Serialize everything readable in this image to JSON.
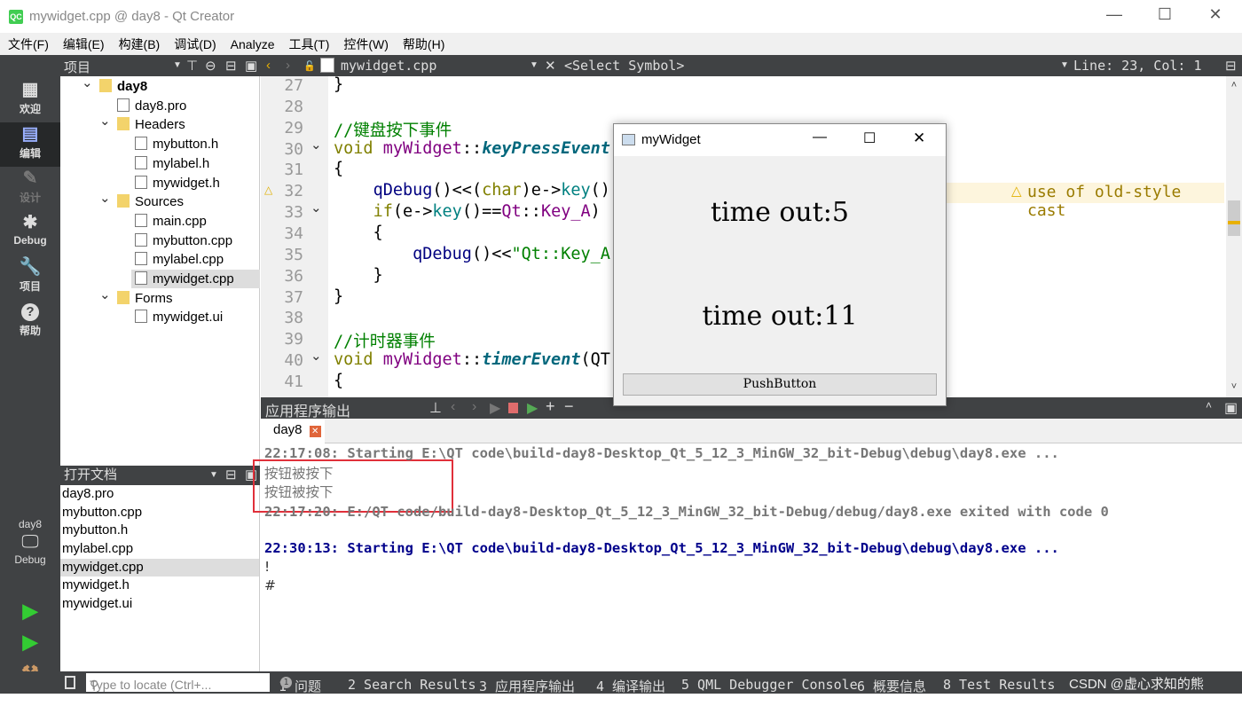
{
  "window": {
    "title": "mywidget.cpp @ day8 - Qt Creator",
    "logo": "QC"
  },
  "menu": [
    "文件(F)",
    "编辑(E)",
    "构建(B)",
    "调试(D)",
    "Analyze",
    "工具(T)",
    "控件(W)",
    "帮助(H)"
  ],
  "toolbar": {
    "panel": "项目",
    "file": "mywidget.cpp",
    "symbol": "<Select Symbol>",
    "position": "Line: 23, Col: 1"
  },
  "modes": [
    {
      "label": "欢迎",
      "icon": "grid-icon"
    },
    {
      "label": "编辑",
      "icon": "edit-icon"
    },
    {
      "label": "设计",
      "icon": "pencil-icon"
    },
    {
      "label": "Debug",
      "icon": "bug-icon"
    },
    {
      "label": "项目",
      "icon": "wrench-icon"
    },
    {
      "label": "帮助",
      "icon": "help-icon"
    }
  ],
  "kit": {
    "name": "day8",
    "mode": "Debug"
  },
  "tree": [
    {
      "label": "day8",
      "level": 0,
      "bold": true,
      "expanded": true
    },
    {
      "label": "day8.pro",
      "level": 1
    },
    {
      "label": "Headers",
      "level": 1,
      "expanded": true
    },
    {
      "label": "mybutton.h",
      "level": 2
    },
    {
      "label": "mylabel.h",
      "level": 2
    },
    {
      "label": "mywidget.h",
      "level": 2
    },
    {
      "label": "Sources",
      "level": 1,
      "expanded": true
    },
    {
      "label": "main.cpp",
      "level": 2
    },
    {
      "label": "mybutton.cpp",
      "level": 2
    },
    {
      "label": "mylabel.cpp",
      "level": 2
    },
    {
      "label": "mywidget.cpp",
      "level": 2,
      "selected": true
    },
    {
      "label": "Forms",
      "level": 1,
      "expanded": true
    },
    {
      "label": "mywidget.ui",
      "level": 2
    }
  ],
  "open_docs": {
    "title": "打开文档",
    "items": [
      "day8.pro",
      "mybutton.cpp",
      "mybutton.h",
      "mylabel.cpp",
      "mywidget.cpp",
      "mywidget.h",
      "mywidget.ui"
    ],
    "selected": "mywidget.cpp"
  },
  "editor": {
    "lines": [
      {
        "n": "27",
        "t": [
          [
            "}",
            ""
          ]
        ]
      },
      {
        "n": "28",
        "t": []
      },
      {
        "n": "29",
        "t": [
          [
            "//键盘按下事件",
            "cm"
          ]
        ]
      },
      {
        "n": "30",
        "fold": true,
        "t": [
          [
            "void ",
            "kw"
          ],
          [
            "myWidget",
            "ty"
          ],
          [
            "::",
            ""
          ],
          [
            "keyPressEvent",
            "fn"
          ]
        ]
      },
      {
        "n": "31",
        "t": [
          [
            "{",
            ""
          ]
        ]
      },
      {
        "n": "32",
        "warn": true,
        "t": [
          [
            "    ",
            ""
          ],
          [
            "qDebug",
            "qd"
          ],
          [
            "()<<(",
            ""
          ],
          [
            "char",
            "kw"
          ],
          [
            ")e->",
            ""
          ],
          [
            "key",
            "mc"
          ],
          [
            "()",
            ""
          ]
        ]
      },
      {
        "n": "33",
        "fold": true,
        "t": [
          [
            "    ",
            ""
          ],
          [
            "if",
            "kw"
          ],
          [
            "(e->",
            ""
          ],
          [
            "key",
            "mc"
          ],
          [
            "()==",
            ""
          ],
          [
            "Qt",
            "ty"
          ],
          [
            "::",
            ""
          ],
          [
            "Key_A",
            "ty"
          ],
          [
            ")",
            ""
          ]
        ]
      },
      {
        "n": "34",
        "t": [
          [
            "    {",
            ""
          ]
        ]
      },
      {
        "n": "35",
        "t": [
          [
            "        ",
            ""
          ],
          [
            "qDebug",
            "qd"
          ],
          [
            "()<<",
            ""
          ],
          [
            "\"Qt::Key_A",
            "st"
          ]
        ]
      },
      {
        "n": "36",
        "t": [
          [
            "    }",
            ""
          ]
        ]
      },
      {
        "n": "37",
        "t": [
          [
            "}",
            ""
          ]
        ]
      },
      {
        "n": "38",
        "t": []
      },
      {
        "n": "39",
        "t": [
          [
            "//计时器事件",
            "cm"
          ]
        ]
      },
      {
        "n": "40",
        "fold": true,
        "t": [
          [
            "void ",
            "kw"
          ],
          [
            "myWidget",
            "ty"
          ],
          [
            "::",
            ""
          ],
          [
            "timerEvent",
            "fn"
          ],
          [
            "(QT",
            ""
          ]
        ]
      },
      {
        "n": "41",
        "t": [
          [
            "{",
            ""
          ]
        ]
      }
    ],
    "warning": "use of old-style cast"
  },
  "output": {
    "title": "应用程序输出",
    "tab": "day8",
    "lines": [
      {
        "text": "22:17:08: Starting E:\\QT code\\build-day8-Desktop_Qt_5_12_3_MinGW_32_bit-Debug\\debug\\day8.exe ...",
        "color": "#777777",
        "bold": true
      },
      {
        "text": "按钮被按下",
        "color": "#777777",
        "bold": false
      },
      {
        "text": "按钮被按下",
        "color": "#777777",
        "bold": false
      },
      {
        "text": "22:17:20: E:/QT code/build-day8-Desktop_Qt_5_12_3_MinGW_32_bit-Debug/debug/day8.exe exited with code 0",
        "color": "#777777",
        "bold": true
      },
      {
        "text": "",
        "color": "#000000",
        "bold": false
      },
      {
        "text": "22:30:13: Starting E:\\QT code\\build-day8-Desktop_Qt_5_12_3_MinGW_32_bit-Debug\\debug\\day8.exe ...",
        "color": "#00008b",
        "bold": true
      },
      {
        "text": "!",
        "color": "#333333",
        "bold": false
      },
      {
        "text": "#",
        "color": "#333333",
        "bold": false
      }
    ]
  },
  "status": {
    "locate_placeholder": "Type to locate (Ctrl+...",
    "tabs": [
      "1 问题",
      "2 Search Results",
      "3 应用程序输出",
      "4 编译输出",
      "5 QML Debugger Console",
      "6 概要信息",
      "8 Test Results"
    ],
    "problem_count": "1",
    "watermark": "CSDN @虚心求知的熊"
  },
  "dialog": {
    "title": "myWidget",
    "label1": "time out:5",
    "label2": "time out:11",
    "button": "PushButton"
  },
  "colors": {
    "dark": "#404244",
    "highlight_box": "#e0303a",
    "warning": "#e0b000"
  }
}
